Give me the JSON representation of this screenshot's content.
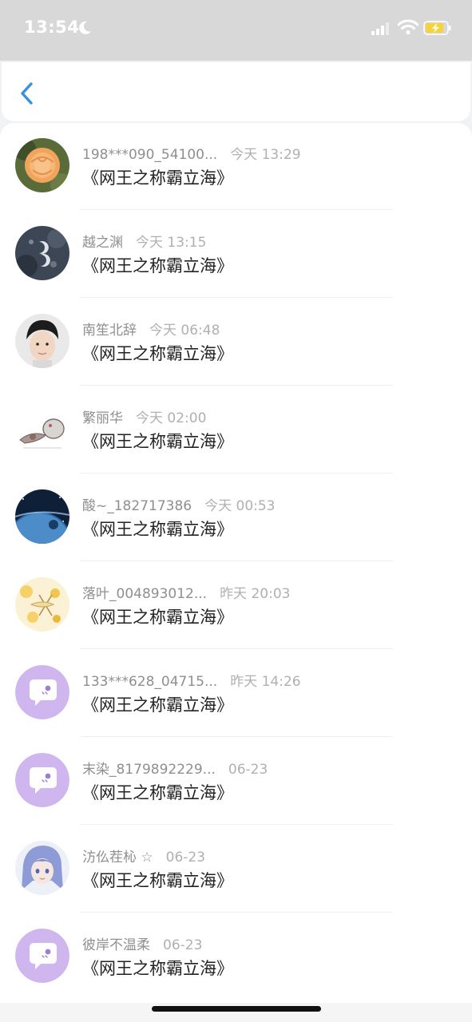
{
  "status_bar": {
    "time": "13:54",
    "icons": [
      "moon-icon",
      "cellular-signal-icon",
      "wifi-icon",
      "battery-charging-icon"
    ],
    "battery_color": "#f5d33a"
  },
  "nav": {
    "back_icon": "chevron-left-icon",
    "accent_color": "#3a8fe0"
  },
  "items": [
    {
      "name": "198***090_54100...",
      "time": "今天 13:29",
      "content": "《网王之称霸立海》",
      "avatar": "flower-photo"
    },
    {
      "name": "越之渊",
      "time": "今天 13:15",
      "content": "《网王之称霸立海》",
      "avatar": "dark-moon-art"
    },
    {
      "name": "南笙北辞",
      "time": "今天 06:48",
      "content": "《网王之称霸立海》",
      "avatar": "portrait-photo"
    },
    {
      "name": "繁丽华",
      "time": "今天 02:00",
      "content": "《网王之称霸立海》",
      "avatar": "sketch-illustration"
    },
    {
      "name": "酸~_182717386",
      "time": "今天 00:53",
      "content": "《网王之称霸立海》",
      "avatar": "planet-space"
    },
    {
      "name": "落叶_004893012...",
      "time": "昨天 20:03",
      "content": "《网王之称霸立海》",
      "avatar": "yellow-pattern"
    },
    {
      "name": "133***628_04715...",
      "time": "昨天 14:26",
      "content": "《网王之称霸立海》",
      "avatar": "default-chat-bubble"
    },
    {
      "name": "末染_8179892229...",
      "time": "06-23",
      "content": "《网王之称霸立海》",
      "avatar": "default-chat-bubble"
    },
    {
      "name": "汸仫茬杺 ☆",
      "time": "06-23",
      "content": "《网王之称霸立海》",
      "avatar": "anime-character"
    },
    {
      "name": "彼岸不温柔",
      "time": "06-23",
      "content": "《网王之称霸立海》",
      "avatar": "default-chat-bubble"
    }
  ]
}
